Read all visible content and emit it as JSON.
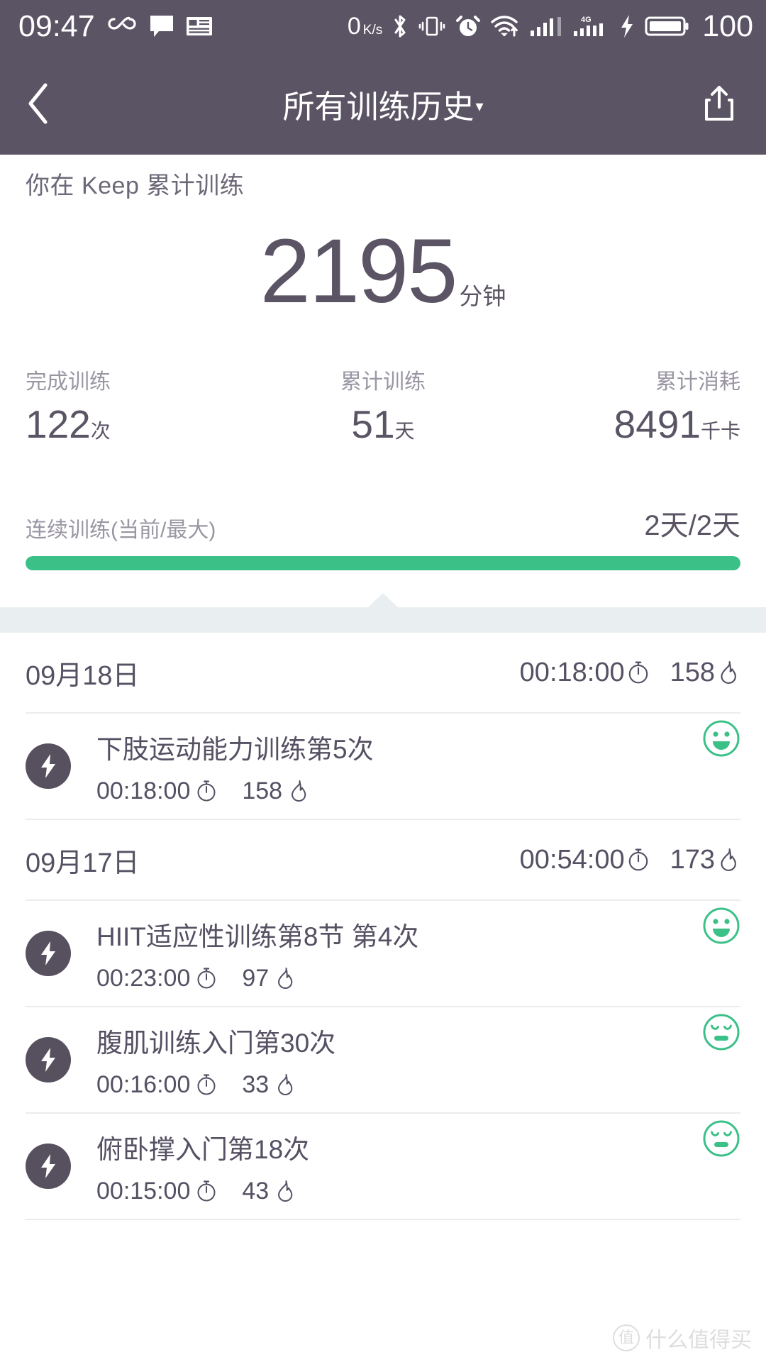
{
  "statusbar": {
    "time": "09:47",
    "net_speed": "0",
    "net_speed_unit": "K/s",
    "battery_percent": "100",
    "icons": [
      "infinity-icon",
      "message-icon",
      "news-icon",
      "bluetooth-icon",
      "vibrate-icon",
      "alarm-icon",
      "wifi-icon",
      "signal-icon",
      "signal-4g-icon",
      "charging-icon",
      "battery-icon"
    ]
  },
  "header": {
    "back_label": "返回",
    "title": "所有训练历史",
    "caret": "▾",
    "share_label": "分享"
  },
  "summary": {
    "caption": "你在 Keep 累计训练",
    "total_minutes": "2195",
    "total_minutes_unit": "分钟",
    "stats": [
      {
        "label": "完成训练",
        "value": "122",
        "unit": "次"
      },
      {
        "label": "累计训练",
        "value": "51",
        "unit": "天"
      },
      {
        "label": "累计消耗",
        "value": "8491",
        "unit": "千卡"
      }
    ],
    "streak": {
      "label": "连续训练(当前/最大)",
      "value": "2天/2天",
      "progress_percent": 100,
      "bar_color": "#3bc088"
    }
  },
  "history": [
    {
      "date": "09月18日",
      "total_duration": "00:18:00",
      "total_calories": "158",
      "entries": [
        {
          "title": "下肢运动能力训练第5次",
          "duration": "00:18:00",
          "calories": "158",
          "mood": "happy"
        }
      ]
    },
    {
      "date": "09月17日",
      "total_duration": "00:54:00",
      "total_calories": "173",
      "entries": [
        {
          "title": "HIIT适应性训练第8节 第4次",
          "duration": "00:23:00",
          "calories": "97",
          "mood": "happy"
        },
        {
          "title": "腹肌训练入门第30次",
          "duration": "00:16:00",
          "calories": "33",
          "mood": "tired"
        },
        {
          "title": "俯卧撑入门第18次",
          "duration": "00:15:00",
          "calories": "43",
          "mood": "tired"
        }
      ]
    }
  ],
  "watermark": {
    "badge": "值",
    "text": "什么值得买"
  },
  "colors": {
    "header_bg": "#5b5464",
    "accent_green": "#3bc088",
    "text_primary": "#565063",
    "text_muted": "#9a96a3",
    "band": "#e9eff0"
  }
}
